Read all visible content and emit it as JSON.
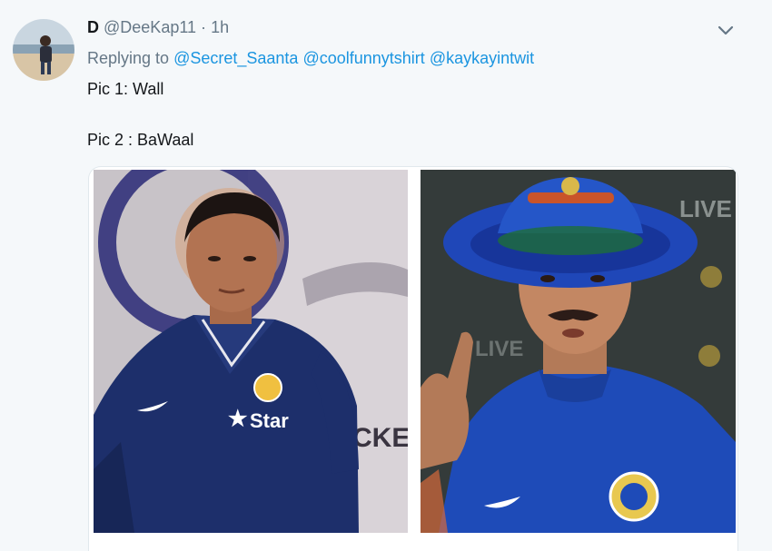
{
  "author": {
    "display_name": "D",
    "handle": "@DeeKap11",
    "separator": "·",
    "time": "1h"
  },
  "reply": {
    "prefix": "Replying to",
    "mentions": [
      "@Secret_Saanta",
      "@coolfunnytshirt",
      "@kaykayintwit"
    ]
  },
  "text": {
    "line1": "Pic 1: Wall",
    "line2": "Pic 2 : BaWaal"
  },
  "media": {
    "left_photo": {
      "jersey_brand": "Star",
      "backdrop_text": "CKE"
    },
    "right_photo": {
      "backdrop_text_1": "LIVE",
      "backdrop_text_2": "LIVE"
    }
  },
  "icons": {
    "menu": "chevron-down-icon"
  },
  "colors": {
    "link": "#1b95e0",
    "secondary_text": "#657786",
    "primary_text": "#14171a",
    "background": "#f5f8fa"
  }
}
